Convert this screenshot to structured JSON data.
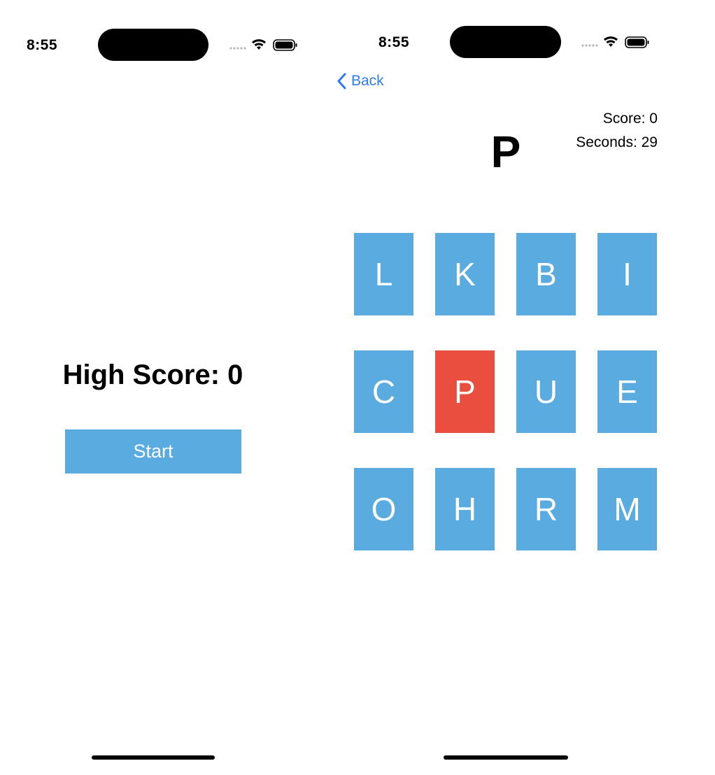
{
  "colors": {
    "tile_blue": "#5aabe0",
    "tile_red": "#e94e3f",
    "link_blue": "#2f7bf5"
  },
  "left_screen": {
    "status_bar": {
      "time": "8:55",
      "icons": [
        "signal-dots-icon",
        "wifi-icon",
        "battery-icon"
      ]
    },
    "high_score_label": "High Score: 0",
    "start_button_label": "Start"
  },
  "right_screen": {
    "status_bar": {
      "time": "8:55",
      "icons": [
        "signal-dots-icon",
        "wifi-icon",
        "battery-icon"
      ]
    },
    "nav": {
      "back_label": "Back",
      "back_icon": "chevron-left-icon"
    },
    "score_text": "Score: 0",
    "seconds_text": "Seconds: 29",
    "target_letter": "P",
    "tiles": [
      {
        "letter": "L",
        "highlighted": false
      },
      {
        "letter": "K",
        "highlighted": false
      },
      {
        "letter": "B",
        "highlighted": false
      },
      {
        "letter": "I",
        "highlighted": false
      },
      {
        "letter": "C",
        "highlighted": false
      },
      {
        "letter": "P",
        "highlighted": true
      },
      {
        "letter": "U",
        "highlighted": false
      },
      {
        "letter": "E",
        "highlighted": false
      },
      {
        "letter": "O",
        "highlighted": false
      },
      {
        "letter": "H",
        "highlighted": false
      },
      {
        "letter": "R",
        "highlighted": false
      },
      {
        "letter": "M",
        "highlighted": false
      }
    ]
  }
}
